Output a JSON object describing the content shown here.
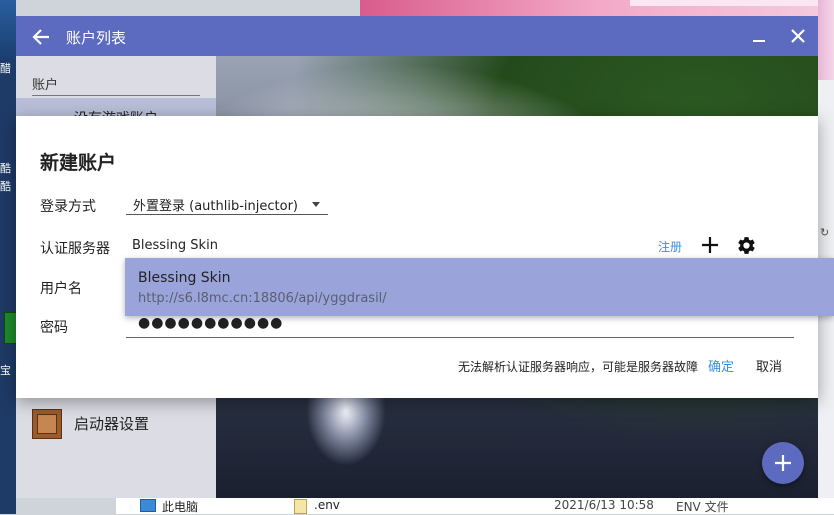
{
  "window": {
    "title": "账户列表"
  },
  "sidebar": {
    "header": "账户",
    "selected_item": "没有游戏账户",
    "settings_label": "启动器设置"
  },
  "dialog": {
    "title": "新建账户",
    "login_method_label": "登录方式",
    "login_method_value": "外置登录 (authlib-injector)",
    "server_label": "认证服务器",
    "server_value": "Blessing Skin",
    "register_link": "注册",
    "username_label": "用户名",
    "password_label": "密码",
    "password_value": "●●●●●●●●●●●",
    "error_message": "无法解析认证服务器响应，可能是服务器故障",
    "confirm_label": "确定",
    "cancel_label": "取消"
  },
  "server_popup": {
    "name": "Blessing Skin",
    "url": "http://s6.l8mc.cn:18806/api/yggdrasil/"
  },
  "explorer": {
    "pc_label": "此电脑",
    "file_name": ".env",
    "file_date": "2021/6/13 10:58",
    "file_type": "ENV 文件"
  },
  "colors": {
    "accent": "#5c6bc0",
    "link": "#3d8ee0",
    "popup": "#9aa4da"
  },
  "icons": [
    "back-arrow-icon",
    "minimize-icon",
    "close-icon",
    "plus-icon",
    "gear-icon",
    "command-block-icon",
    "add-fab-icon"
  ]
}
